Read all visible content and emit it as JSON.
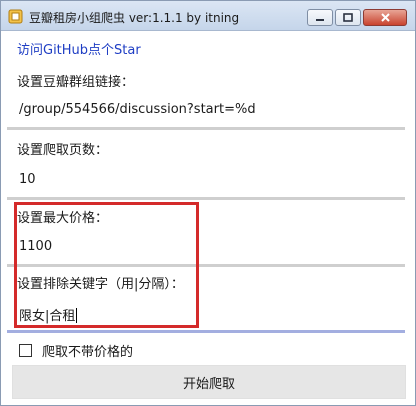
{
  "window": {
    "title": "豆瓣租房小组爬虫 ver:1.1.1 by itning"
  },
  "link": {
    "text": "访问GitHub点个Star"
  },
  "group_url": {
    "label": "设置豆瓣群组链接：",
    "value": "/group/554566/discussion?start=%d"
  },
  "pages": {
    "label": "设置爬取页数：",
    "value": "10"
  },
  "max_price": {
    "label": "设置最大价格：",
    "value": "1100"
  },
  "exclude": {
    "label": "设置排除关键字（用|分隔）：",
    "value": "限女|合租"
  },
  "no_price": {
    "label": "爬取不带价格的",
    "checked": false
  },
  "start_button": {
    "label": "开始爬取"
  },
  "colors": {
    "link": "#1f3ec4",
    "highlight": "#d42a2a",
    "focus_line": "#a3aee0"
  },
  "icons": {
    "app": "app-icon",
    "minimize": "minimize-icon",
    "maximize": "maximize-icon",
    "close": "close-icon"
  }
}
